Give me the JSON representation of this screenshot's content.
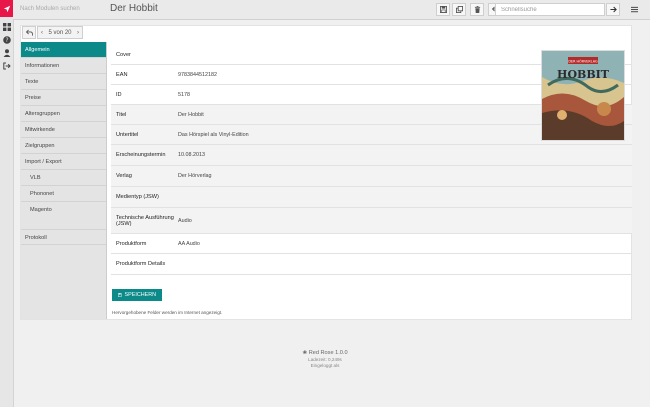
{
  "topbar": {
    "module_search_placeholder": "Nach Modulen suchen",
    "title": "Der Hobbit",
    "quick_search_placeholder": "Schnellsuche"
  },
  "pager": {
    "label": "5 von 20"
  },
  "nav": {
    "items": [
      "Allgemein",
      "Informationen",
      "Texte",
      "Preise",
      "Altersgruppen",
      "Mitwirkende",
      "Zielgruppen",
      "Import / Export",
      "VLB",
      "Phononet",
      "Magento",
      "Protokoll"
    ]
  },
  "form": {
    "fields": [
      {
        "label": "Cover",
        "value": ""
      },
      {
        "label": "EAN",
        "value": "9783844512182"
      },
      {
        "label": "ID",
        "value": "5178"
      },
      {
        "label": "Titel",
        "value": "Der Hobbit"
      },
      {
        "label": "Untertitel",
        "value": "Das Hörspiel als Vinyl-Edition"
      },
      {
        "label": "Erscheinungstermin",
        "value": "10.08.2013"
      },
      {
        "label": "Verlag",
        "value": "Der Hörverlag"
      },
      {
        "label": "Medientyp (JSW)",
        "value": ""
      },
      {
        "label": "Technische Ausführung (JSW)",
        "value": "Audio"
      },
      {
        "label": "Produktform",
        "value": "AA Audio"
      },
      {
        "label": "Produktform Details",
        "value": ""
      }
    ],
    "save_label": "SPEICHERN",
    "hint": "Hervorgehobene Felder werden im Internet angezeigt."
  },
  "cover": {
    "series_badge": "DER HÖRVERLAG",
    "title_text": "HOBBIT"
  },
  "footer": {
    "version": "Red Rose 1.0.0",
    "load_time": "Ladezeit: 0,249s",
    "login_status": "Eingeloggt als"
  },
  "colors": {
    "accent": "#0c8a8a",
    "logo_red": "#e8174a"
  }
}
